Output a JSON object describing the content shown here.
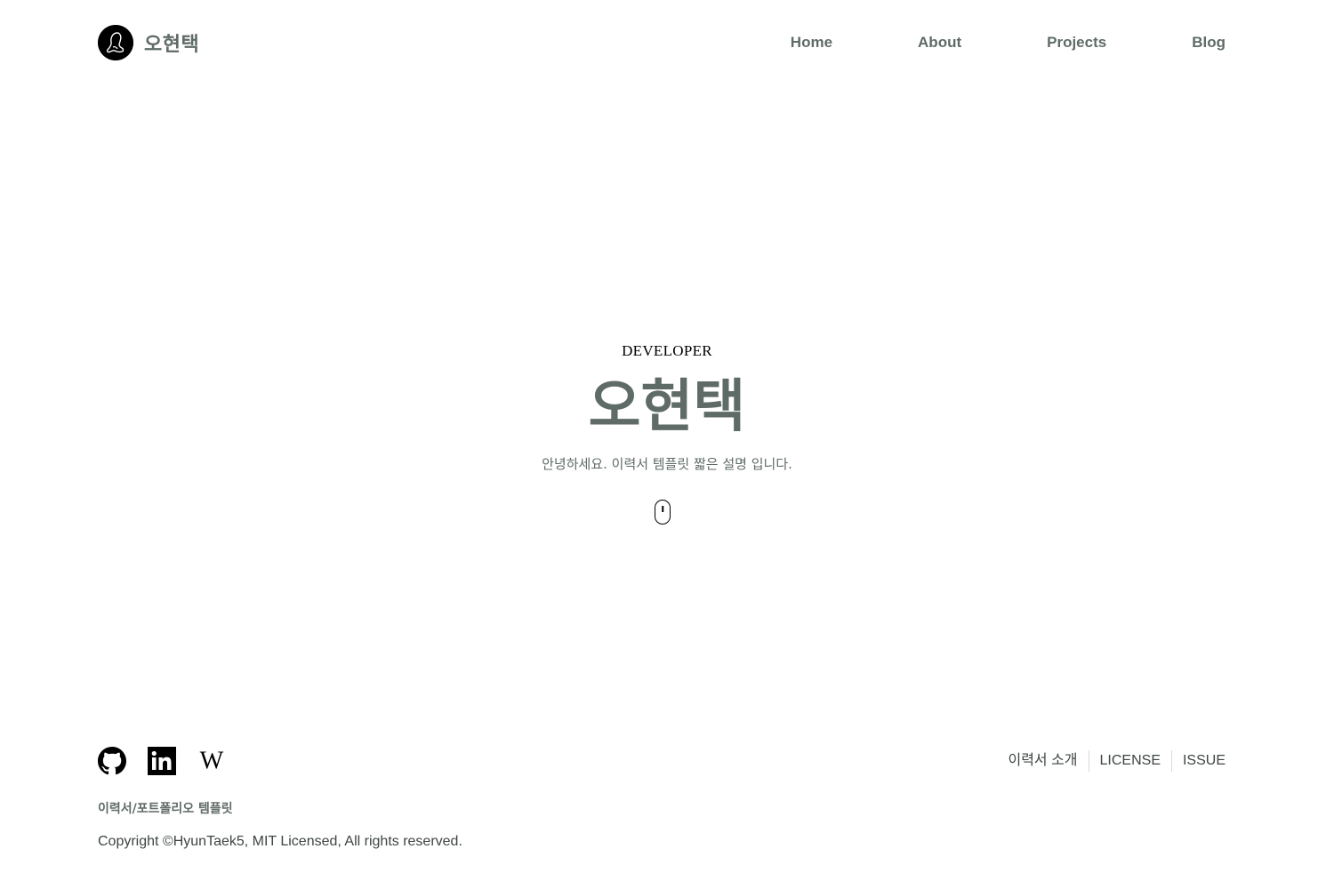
{
  "header": {
    "brand_name": "오현택",
    "nav": [
      {
        "label": "Home"
      },
      {
        "label": "About"
      },
      {
        "label": "Projects"
      },
      {
        "label": "Blog"
      }
    ]
  },
  "hero": {
    "eyebrow": "DEVELOPER",
    "title": "오현택",
    "description": "안녕하세요. 이력서 템플릿 짧은 설명 입니다."
  },
  "footer": {
    "socials": [
      {
        "icon": "github-icon"
      },
      {
        "icon": "linkedin-icon"
      },
      {
        "icon": "wikipedia-icon",
        "glyph": "W"
      }
    ],
    "links": [
      {
        "label": "이력서 소개"
      },
      {
        "label": "LICENSE"
      },
      {
        "label": "ISSUE"
      }
    ],
    "subtitle": "이력서/포트폴리오 템플릿",
    "copyright": "Copyright ©HyunTaek5, MIT Licensed, All rights reserved."
  },
  "colors": {
    "primary_text": "#5f6b67",
    "dark_text": "#3e4543",
    "logo_bg": "#000000"
  }
}
